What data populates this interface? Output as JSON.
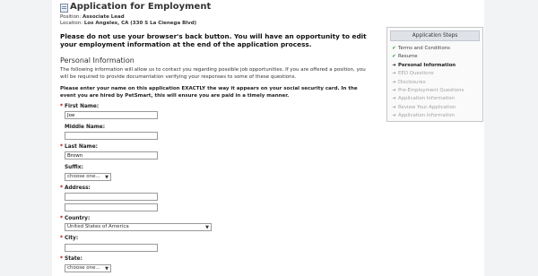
{
  "header": {
    "title": "Application for Employment",
    "position_label": "Position:",
    "position_value": "Associate Lead",
    "location_label": "Location:",
    "location_value": "Los Angeles, CA  (330 S La Cienega Blvd)"
  },
  "warning": "Please do not use your browser's back button. You will have an opportunity to edit your employment information at the end of the application process.",
  "section": {
    "title": "Personal Information",
    "intro": "The following information will allow us to contact you regarding possible job opportunities. If you are offered a position, you will be required to provide documentation verifying your responses to some of these questions.",
    "instructions": "Please enter your name on this application EXACTLY the way it appears on your social security card. In the event you are hired by PetSmart, this will ensure you are paid in a timely manner."
  },
  "form": {
    "required_marker": "*",
    "first_name": {
      "label": "First Name:",
      "value": "Joe"
    },
    "middle_name": {
      "label": "Middle Name:",
      "value": ""
    },
    "last_name": {
      "label": "Last Name:",
      "value": "Brown"
    },
    "suffix": {
      "label": "Suffix:",
      "value": "choose one..."
    },
    "address": {
      "label": "Address:",
      "value1": "",
      "value2": ""
    },
    "country": {
      "label": "Country:",
      "value": "United States of America"
    },
    "city": {
      "label": "City:",
      "value": ""
    },
    "state": {
      "label": "State:",
      "value": "choose one..."
    }
  },
  "steps": {
    "title": "Application Steps",
    "items": [
      {
        "label": "Terms and Conditions",
        "status": "done",
        "marker": "✔"
      },
      {
        "label": "Resume",
        "status": "done",
        "marker": "✔"
      },
      {
        "label": "Personal Information",
        "status": "current",
        "marker": "➜"
      },
      {
        "label": "EEO Questions",
        "status": "pending",
        "marker": "➜"
      },
      {
        "label": "Disclosures",
        "status": "pending",
        "marker": "➜"
      },
      {
        "label": "Pre-Employment Questions",
        "status": "pending",
        "marker": "➜"
      },
      {
        "label": "Application Information",
        "status": "pending",
        "marker": "➜"
      },
      {
        "label": "Review Your Application",
        "status": "pending",
        "marker": "➜"
      },
      {
        "label": "Application Information",
        "status": "pending",
        "marker": "➜"
      }
    ]
  }
}
